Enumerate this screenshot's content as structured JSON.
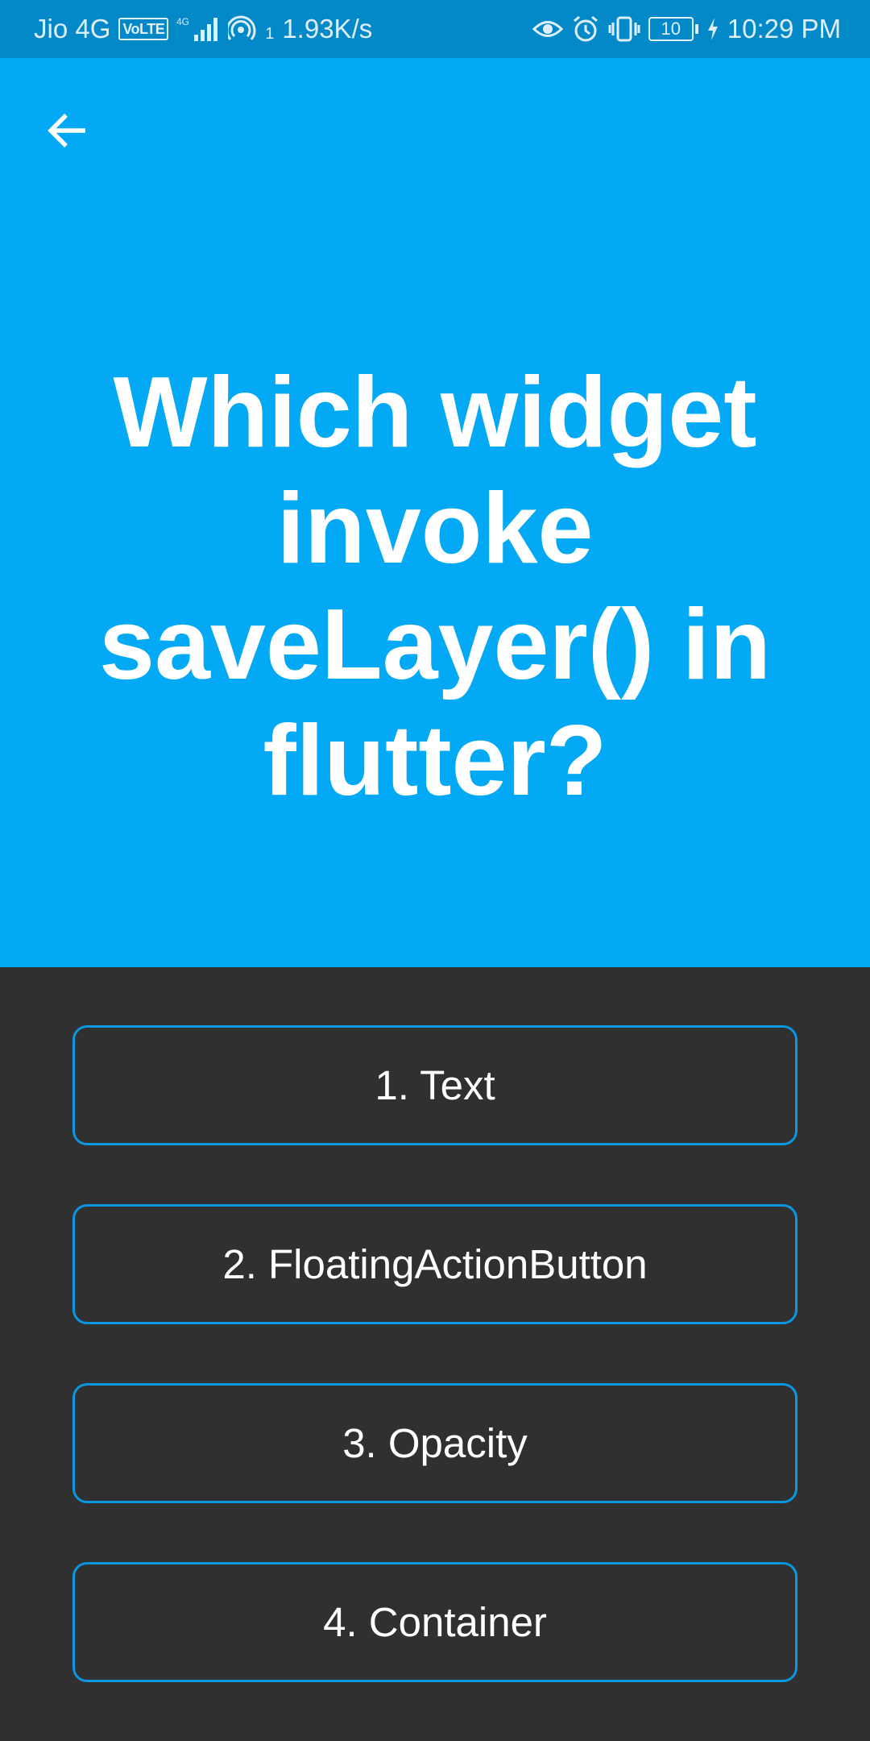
{
  "status_bar": {
    "carrier": "Jio 4G",
    "volte": "VoLTE",
    "network": "4G",
    "hotspot_count": "1",
    "speed": "1.93K/s",
    "battery": "10",
    "time": "10:29 PM"
  },
  "question": {
    "text": "Which widget invoke saveLayer() in flutter?"
  },
  "options": [
    {
      "label": "1. Text"
    },
    {
      "label": "2. FloatingActionButton"
    },
    {
      "label": "3. Opacity"
    },
    {
      "label": "4. Container"
    }
  ],
  "colors": {
    "accent": "#03a9f4",
    "status_bar": "#0489c8",
    "background": "#303030",
    "option_border": "#0a97df"
  },
  "icons": {
    "back": "arrow-left-icon"
  }
}
